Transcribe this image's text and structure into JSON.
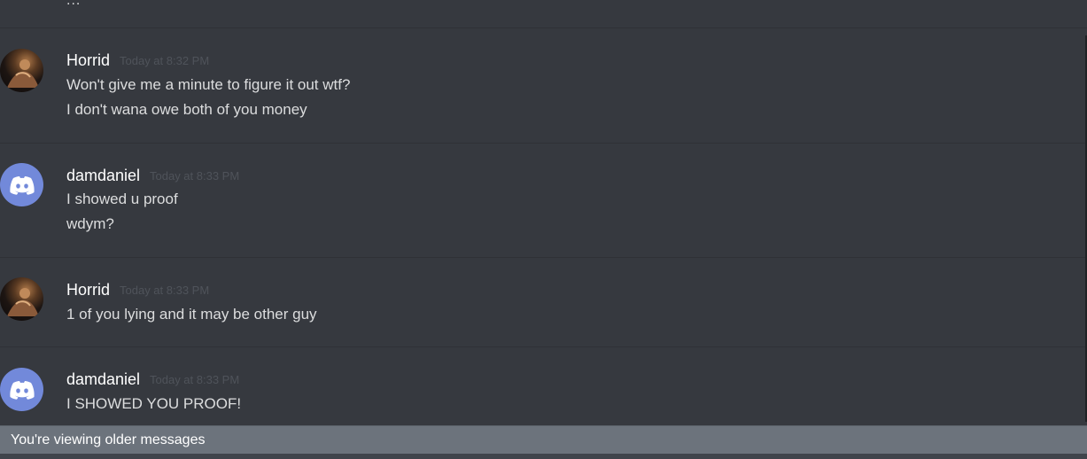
{
  "top_fragment": "...",
  "messages": [
    {
      "author": "Horrid",
      "timestamp": "Today at 8:32 PM",
      "avatar": "photo-avatar",
      "lines": [
        "Won't give me a minute to figure it out wtf?",
        "I don't wana owe both of you money"
      ]
    },
    {
      "author": "damdaniel",
      "timestamp": "Today at 8:33 PM",
      "avatar": "discord-logo-icon",
      "lines": [
        "I showed u proof",
        "wdym?"
      ]
    },
    {
      "author": "Horrid",
      "timestamp": "Today at 8:33 PM",
      "avatar": "photo-avatar",
      "lines": [
        "1 of you lying and it may be other guy"
      ]
    },
    {
      "author": "damdaniel",
      "timestamp": "Today at 8:33 PM",
      "avatar": "discord-logo-icon",
      "lines": [
        "I SHOWED YOU PROOF!"
      ]
    }
  ],
  "older_messages_bar": "You're viewing older messages",
  "colors": {
    "background": "#36393f",
    "username": "#ffffff",
    "message_text": "#dcddde",
    "timestamp": "#4f535a",
    "discord_blurple": "#7289da",
    "older_bar": "#6c737c"
  }
}
